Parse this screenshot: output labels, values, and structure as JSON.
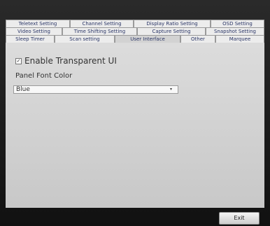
{
  "tabs": {
    "row1": [
      "Teletext Setting",
      "Channel Setting",
      "Display Ratio Setting",
      "OSD Setting"
    ],
    "row2": [
      "Video Setting",
      "Time Shifting Setting",
      "Capture Setting",
      "Snapshot Setting"
    ],
    "row3": [
      "Sleep Timer",
      "Scan setting",
      "User Interface",
      "Other",
      "Marquee"
    ],
    "active": "User Interface"
  },
  "panel": {
    "transparent_ui": {
      "label": "Enable Transparent UI",
      "checked": true,
      "check_mark": "✓"
    },
    "font_color": {
      "label": "Panel Font Color",
      "selected": "Blue",
      "arrow": "▾"
    }
  },
  "footer": {
    "exit_label": "Exit"
  }
}
